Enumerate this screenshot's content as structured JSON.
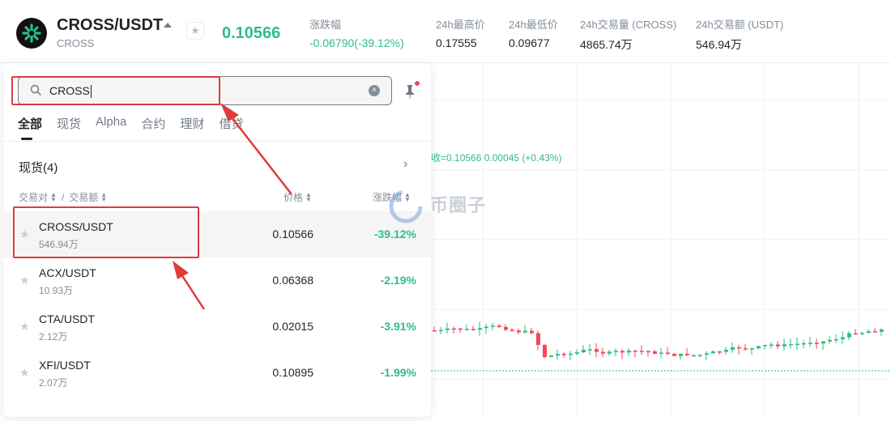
{
  "header": {
    "pair": "CROSS/USDT",
    "base": "CROSS",
    "last_price": "0.10566",
    "stats": [
      {
        "label": "涨跌幅",
        "value": "-0.06790(-39.12%)",
        "color": "green"
      },
      {
        "label": "24h最高价",
        "value": "0.17555"
      },
      {
        "label": "24h最低价",
        "value": "0.09677"
      },
      {
        "label": "24h交易量 (CROSS)",
        "value": "4865.74万"
      },
      {
        "label": "24h交易额 (USDT)",
        "value": "546.94万"
      }
    ]
  },
  "chart": {
    "info_line": "收=0.10566  0.00045 (+0.43%)"
  },
  "search": {
    "value": "CROSS"
  },
  "tabs": [
    "全部",
    "现货",
    "Alpha",
    "合约",
    "理财",
    "借贷"
  ],
  "section": {
    "title": "现货(4)"
  },
  "columns": {
    "pair": "交易对",
    "separator": "/",
    "volume": "交易额",
    "price": "价格",
    "change": "涨跌幅"
  },
  "rows": [
    {
      "pair": "CROSS/USDT",
      "volume": "546.94万",
      "price": "0.10566",
      "change": "-39.12%"
    },
    {
      "pair": "ACX/USDT",
      "volume": "10.93万",
      "price": "0.06368",
      "change": "-2.19%"
    },
    {
      "pair": "CTA/USDT",
      "volume": "2.12万",
      "price": "0.02015",
      "change": "-3.91%"
    },
    {
      "pair": "XFI/USDT",
      "volume": "2.07万",
      "price": "0.10895",
      "change": "-1.99%"
    }
  ],
  "watermark": "币圈子",
  "colors": {
    "green": "#2ebd85",
    "red": "#f6465d",
    "annotation": "#e03b3b"
  }
}
